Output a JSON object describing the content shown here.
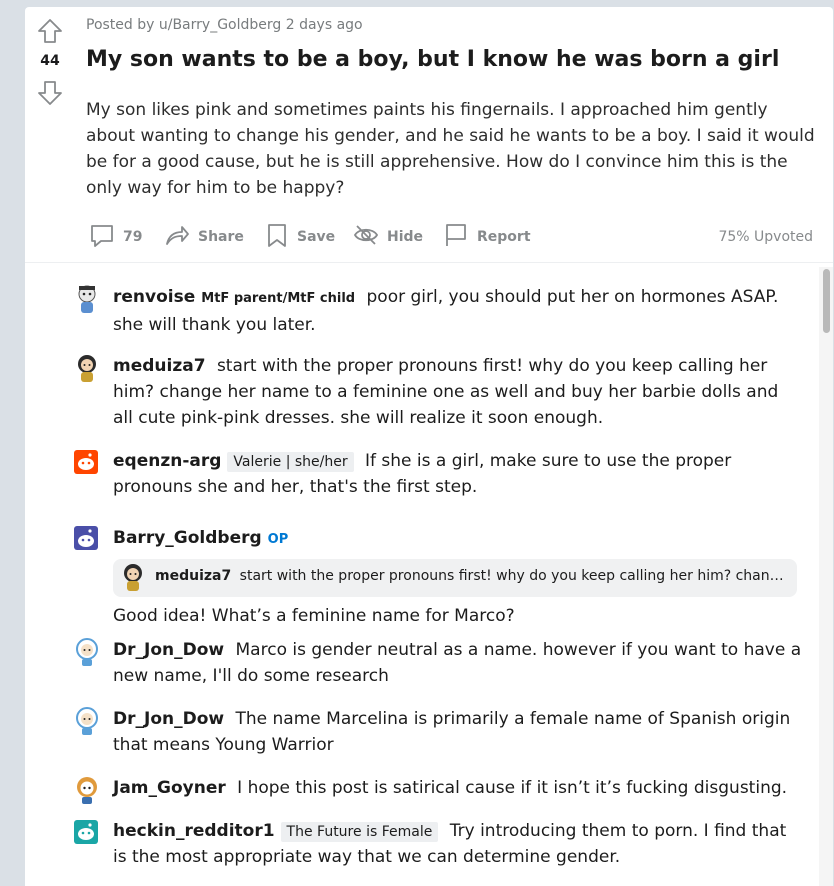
{
  "post": {
    "score": "44",
    "meta": "Posted by u/Barry_Goldberg 2 days ago",
    "title": "My son wants to be a boy, but I know he was born a girl",
    "body": "My son likes pink and sometimes paints his fingernails. I approached him gently about wanting to change his gender, and he said he wants to be a boy. I said it would be for a good cause, but he is still apprehensive. How do I convince him this is the only way for him to be happy?",
    "actions": {
      "comments_count": "79",
      "share": "Share",
      "save": "Save",
      "hide": "Hide",
      "report": "Report"
    },
    "upvoted": "75% Upvoted"
  },
  "comments": [
    {
      "user": "renvoise",
      "flair": "MtF parent/MtF child",
      "text": "poor girl, you should put her on hormones ASAP. she will thank you later."
    },
    {
      "user": "meduiza7",
      "text": "start with the proper pronouns first! why do you keep calling her him? change her name to a feminine one as well and buy her barbie dolls and all cute pink-pink dresses. she will realize it soon enough."
    },
    {
      "user": "eqenzn-arg",
      "flair": "Valerie | she/her",
      "text": "If she is a girl, make sure to use the proper pronouns she and her, that's the first step."
    },
    {
      "user": "Barry_Goldberg",
      "op_label": "OP",
      "quote_user": "meduiza7",
      "quote_text": "start with the proper pronouns first! why do you keep calling her him? chang...",
      "text": "Good idea! What’s a feminine name for Marco?"
    },
    {
      "user": "Dr_Jon_Dow",
      "text": "Marco is gender neutral as a name. however if you want to have a new name, I'll do some research"
    },
    {
      "user": "Dr_Jon_Dow",
      "text": "The name Marcelina is primarily a female name of Spanish origin that means Young Warrior"
    },
    {
      "user": "Jam_Goyner",
      "text": "I hope this post is satirical cause if it isn’t it’s fucking disgusting."
    },
    {
      "user": "heckin_redditor1",
      "flair": "The Future is Female",
      "text": "Try introducing them to porn. I find that is the most appropriate way that we can determine gender."
    }
  ]
}
